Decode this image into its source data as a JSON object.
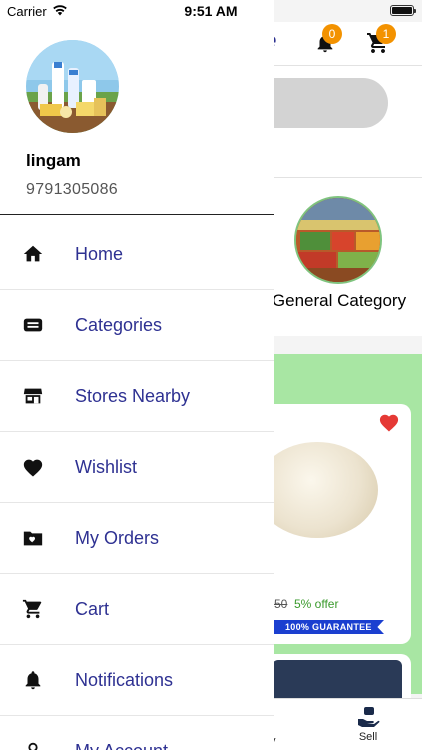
{
  "status_bar": {
    "carrier": "Carrier",
    "time": "9:51 AM"
  },
  "background": {
    "header": {
      "notification_count": "0",
      "cart_count": "1"
    },
    "category": {
      "label": "General Category"
    },
    "product": {
      "price_struck": "50",
      "offer": "5% offer",
      "guarantee": "100% GUARANTEE"
    },
    "tabbar": {
      "partial_label": "y",
      "sell_label": "Sell"
    }
  },
  "drawer": {
    "user": {
      "name": "lingam",
      "phone": "9791305086"
    },
    "menu": [
      {
        "label": "Home",
        "icon": "home-icon"
      },
      {
        "label": "Categories",
        "icon": "categories-icon"
      },
      {
        "label": "Stores Nearby",
        "icon": "store-icon"
      },
      {
        "label": "Wishlist",
        "icon": "heart-icon"
      },
      {
        "label": "My Orders",
        "icon": "orders-folder-icon"
      },
      {
        "label": "Cart",
        "icon": "cart-icon"
      },
      {
        "label": "Notifications",
        "icon": "bell-icon"
      },
      {
        "label": "My Account",
        "icon": "account-icon"
      }
    ]
  },
  "colors": {
    "menu_text": "#2e3192",
    "badge": "#f39200",
    "promo_green": "#a8e6a3",
    "guarantee_blue": "#1b3fd0"
  }
}
